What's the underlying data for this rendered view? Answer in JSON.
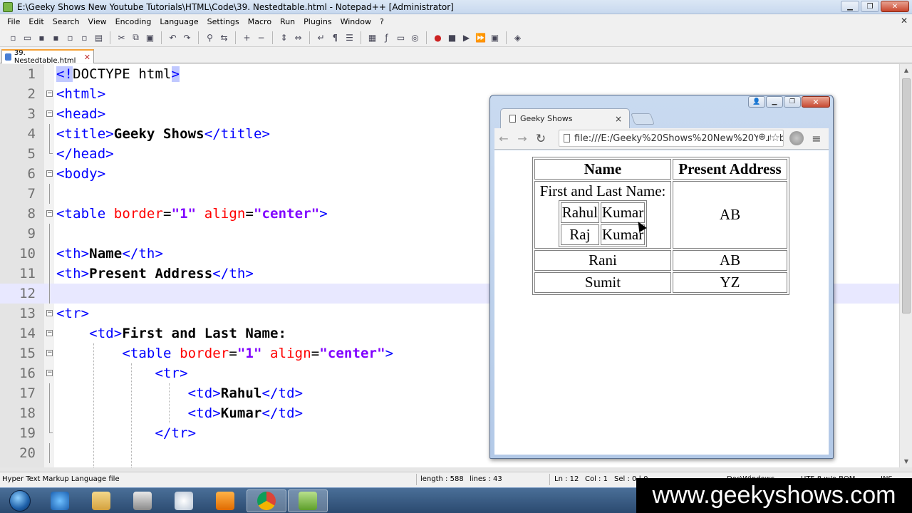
{
  "window": {
    "title": "E:\\Geeky Shows New Youtube Tutorials\\HTML\\Code\\39. Nestedtable.html - Notepad++ [Administrator]",
    "min": "▁",
    "max": "❐",
    "close": "✕"
  },
  "menu": [
    "File",
    "Edit",
    "Search",
    "View",
    "Encoding",
    "Language",
    "Settings",
    "Macro",
    "Run",
    "Plugins",
    "Window",
    "?"
  ],
  "menu_close": "✕",
  "toolbar_icons": [
    "new-file-icon",
    "open-file-icon",
    "save-icon",
    "save-all-icon",
    "close-icon",
    "close-all-icon",
    "print-icon",
    "cut-icon",
    "copy-icon",
    "paste-icon",
    "undo-icon",
    "redo-icon",
    "find-icon",
    "replace-icon",
    "zoom-in-icon",
    "zoom-out-icon",
    "sync-vertical-icon",
    "sync-horizontal-icon",
    "word-wrap-icon",
    "show-all-chars-icon",
    "indent-guide-icon",
    "doc-map-icon",
    "function-list-icon",
    "folder-workspace-icon",
    "monitoring-icon",
    "record-macro-icon",
    "stop-macro-icon",
    "play-macro-icon",
    "run-macro-multiple-icon",
    "save-macro-icon",
    "launch-browser-icon"
  ],
  "tab": {
    "label": "39. Nestedtable.html",
    "close": "✕"
  },
  "line_numbers": [
    "1",
    "2",
    "3",
    "4",
    "5",
    "6",
    "7",
    "8",
    "9",
    "10",
    "11",
    "12",
    "13",
    "14",
    "15",
    "16",
    "17",
    "18",
    "19",
    "20"
  ],
  "code": {
    "l1": {
      "a": "<!",
      "b": "DOCTYPE html",
      "c": ">"
    },
    "l2": {
      "a": "<html>"
    },
    "l3": {
      "a": "<head>"
    },
    "l4": {
      "a": "<title>",
      "b": "Geeky Shows",
      "c": "</title>"
    },
    "l5": {
      "a": "</head>"
    },
    "l6": {
      "a": "<body>"
    },
    "l8": {
      "a": "<table ",
      "b": "border",
      "c": "=",
      "d": "\"1\"",
      "e": " ",
      "f": "align",
      "g": "=",
      "h": "\"center\"",
      "i": ">"
    },
    "l10": {
      "a": "<th>",
      "b": "Name",
      "c": "</th>"
    },
    "l11": {
      "a": "<th>",
      "b": "Present Address",
      "c": "</th>"
    },
    "l13": {
      "a": "<tr>"
    },
    "l14": {
      "ind": "    ",
      "a": "<td>",
      "b": "First and Last Name:"
    },
    "l15": {
      "ind": "        ",
      "a": "<table ",
      "b": "border",
      "c": "=",
      "d": "\"1\"",
      "e": " ",
      "f": "align",
      "g": "=",
      "h": "\"center\"",
      "i": ">"
    },
    "l16": {
      "ind": "            ",
      "a": "<tr>"
    },
    "l17": {
      "ind": "                ",
      "a": "<td>",
      "b": "Rahul",
      "c": "</td>"
    },
    "l18": {
      "ind": "                ",
      "a": "<td>",
      "b": "Kumar",
      "c": "</td>"
    },
    "l19": {
      "ind": "            ",
      "a": "</tr>"
    }
  },
  "status": {
    "file_type": "Hyper Text Markup Language file",
    "length": "length : 588",
    "lines": "lines : 43",
    "ln": "Ln : 12",
    "col": "Col : 1",
    "sel": "Sel : 0 | 0",
    "eol": "Dos\\Windows",
    "encoding": "UTF-8 w/o BOM",
    "mode": "INS"
  },
  "taskbar_icons": [
    "start-orb-icon",
    "internet-explorer-icon",
    "file-explorer-icon",
    "dictionary-app-icon",
    "snipping-tool-icon",
    "media-player-icon",
    "chrome-icon",
    "notepad-plus-plus-icon"
  ],
  "browser": {
    "tab_title": "Geeky Shows",
    "tab_close": "×",
    "back": "←",
    "forward": "→",
    "reload": "↻",
    "url": "file:///E:/Geeky%20Shows%20New%20Youtube%20Tutorials/HTML/Code/39.%20Nestedtable.html",
    "zoom": "⊕",
    "star": "☆",
    "menu": "≡",
    "ctrl_user": "👤",
    "ctrl_min": "▁",
    "ctrl_max": "❐",
    "ctrl_close": "✕"
  },
  "rendered_table": {
    "headers": [
      "Name",
      "Present Address"
    ],
    "first_row_label": "First and Last Name:",
    "nested_rows": [
      [
        "Rahul",
        "Kumar"
      ],
      [
        "Raj",
        "Kumar"
      ]
    ],
    "first_row_address": "AB",
    "rows": [
      [
        "Rani",
        "AB"
      ],
      [
        "Sumit",
        "YZ"
      ]
    ]
  },
  "watermark": "www.geekyshows.com"
}
